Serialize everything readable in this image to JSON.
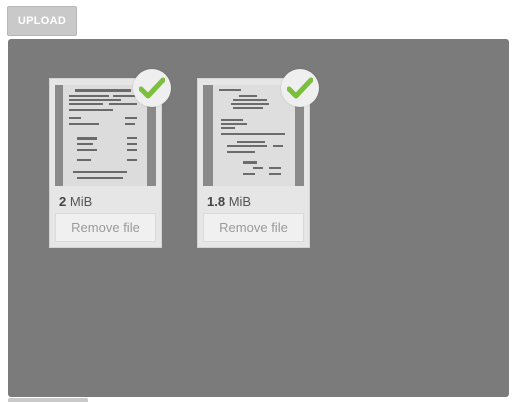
{
  "upload": {
    "label": "UPLOAD"
  },
  "colors": {
    "dropzone_bg": "#7b7b7b",
    "check": "#7cbf3c",
    "card_bg": "#e6e6e6"
  },
  "files": [
    {
      "size_value": "2",
      "size_unit": "MiB",
      "remove_label": "Remove file",
      "status_icon": "check-icon"
    },
    {
      "size_value": "1.8",
      "size_unit": "MiB",
      "remove_label": "Remove file",
      "status_icon": "check-icon"
    }
  ]
}
